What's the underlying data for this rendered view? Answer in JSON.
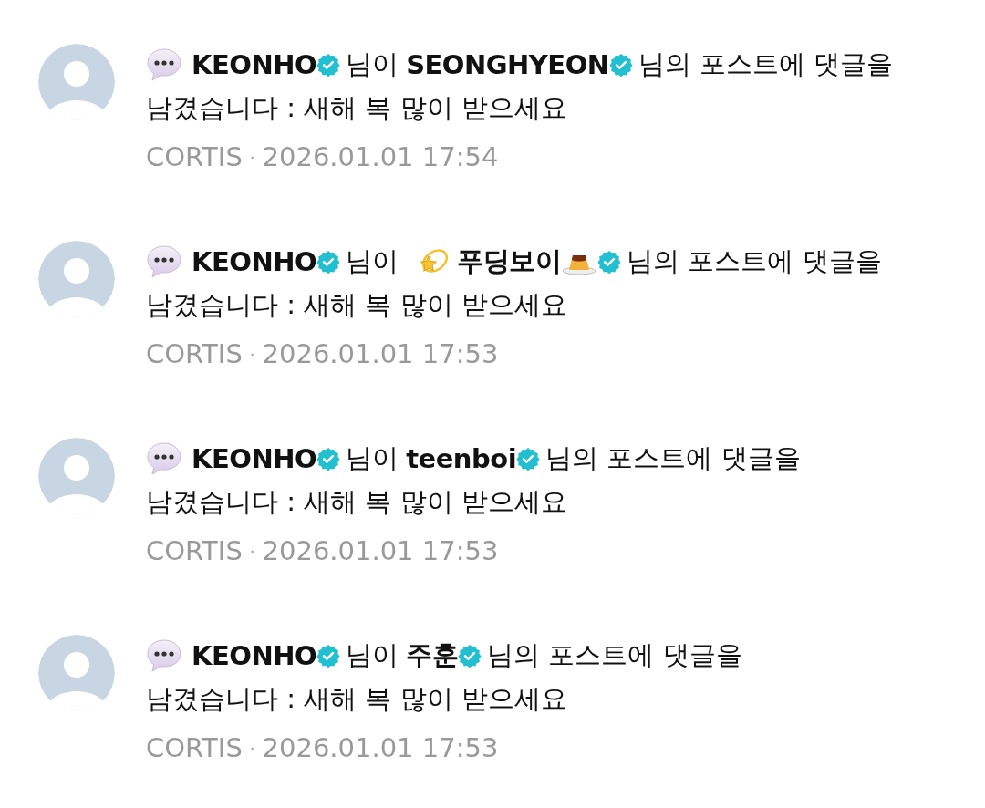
{
  "notifications": [
    {
      "actor": "KEONHO",
      "actor_verified": true,
      "connector": "님이",
      "target": "SEONGHYEON",
      "target_verified": true,
      "target_decorated": false,
      "suffix": "님의 포스트에 댓글을",
      "comment": "남겼습니다 : 새해 복 많이 받으세요",
      "source": "CORTIS",
      "separator": "·",
      "time": "2026.01.01 17:54"
    },
    {
      "actor": "KEONHO",
      "actor_verified": true,
      "connector": "님이",
      "target": "푸딩보이",
      "target_verified": true,
      "target_decorated": true,
      "suffix": "님의 포스트에 댓글을",
      "comment": "남겼습니다 : 새해 복 많이 받으세요",
      "source": "CORTIS",
      "separator": "·",
      "time": "2026.01.01 17:53"
    },
    {
      "actor": "KEONHO",
      "actor_verified": true,
      "connector": "님이",
      "target": "teenboi",
      "target_verified": true,
      "target_decorated": false,
      "suffix": "님의 포스트에 댓글을",
      "comment": "남겼습니다 : 새해 복 많이 받으세요",
      "source": "CORTIS",
      "separator": "·",
      "time": "2026.01.01 17:53"
    },
    {
      "actor": "KEONHO",
      "actor_verified": true,
      "connector": "님이",
      "target": "주훈",
      "target_verified": true,
      "target_decorated": false,
      "suffix": "님의 포스트에 댓글을",
      "comment": "남겼습니다 : 새해 복 많이 받으세요",
      "source": "CORTIS",
      "separator": "·",
      "time": "2026.01.01 17:53"
    }
  ]
}
